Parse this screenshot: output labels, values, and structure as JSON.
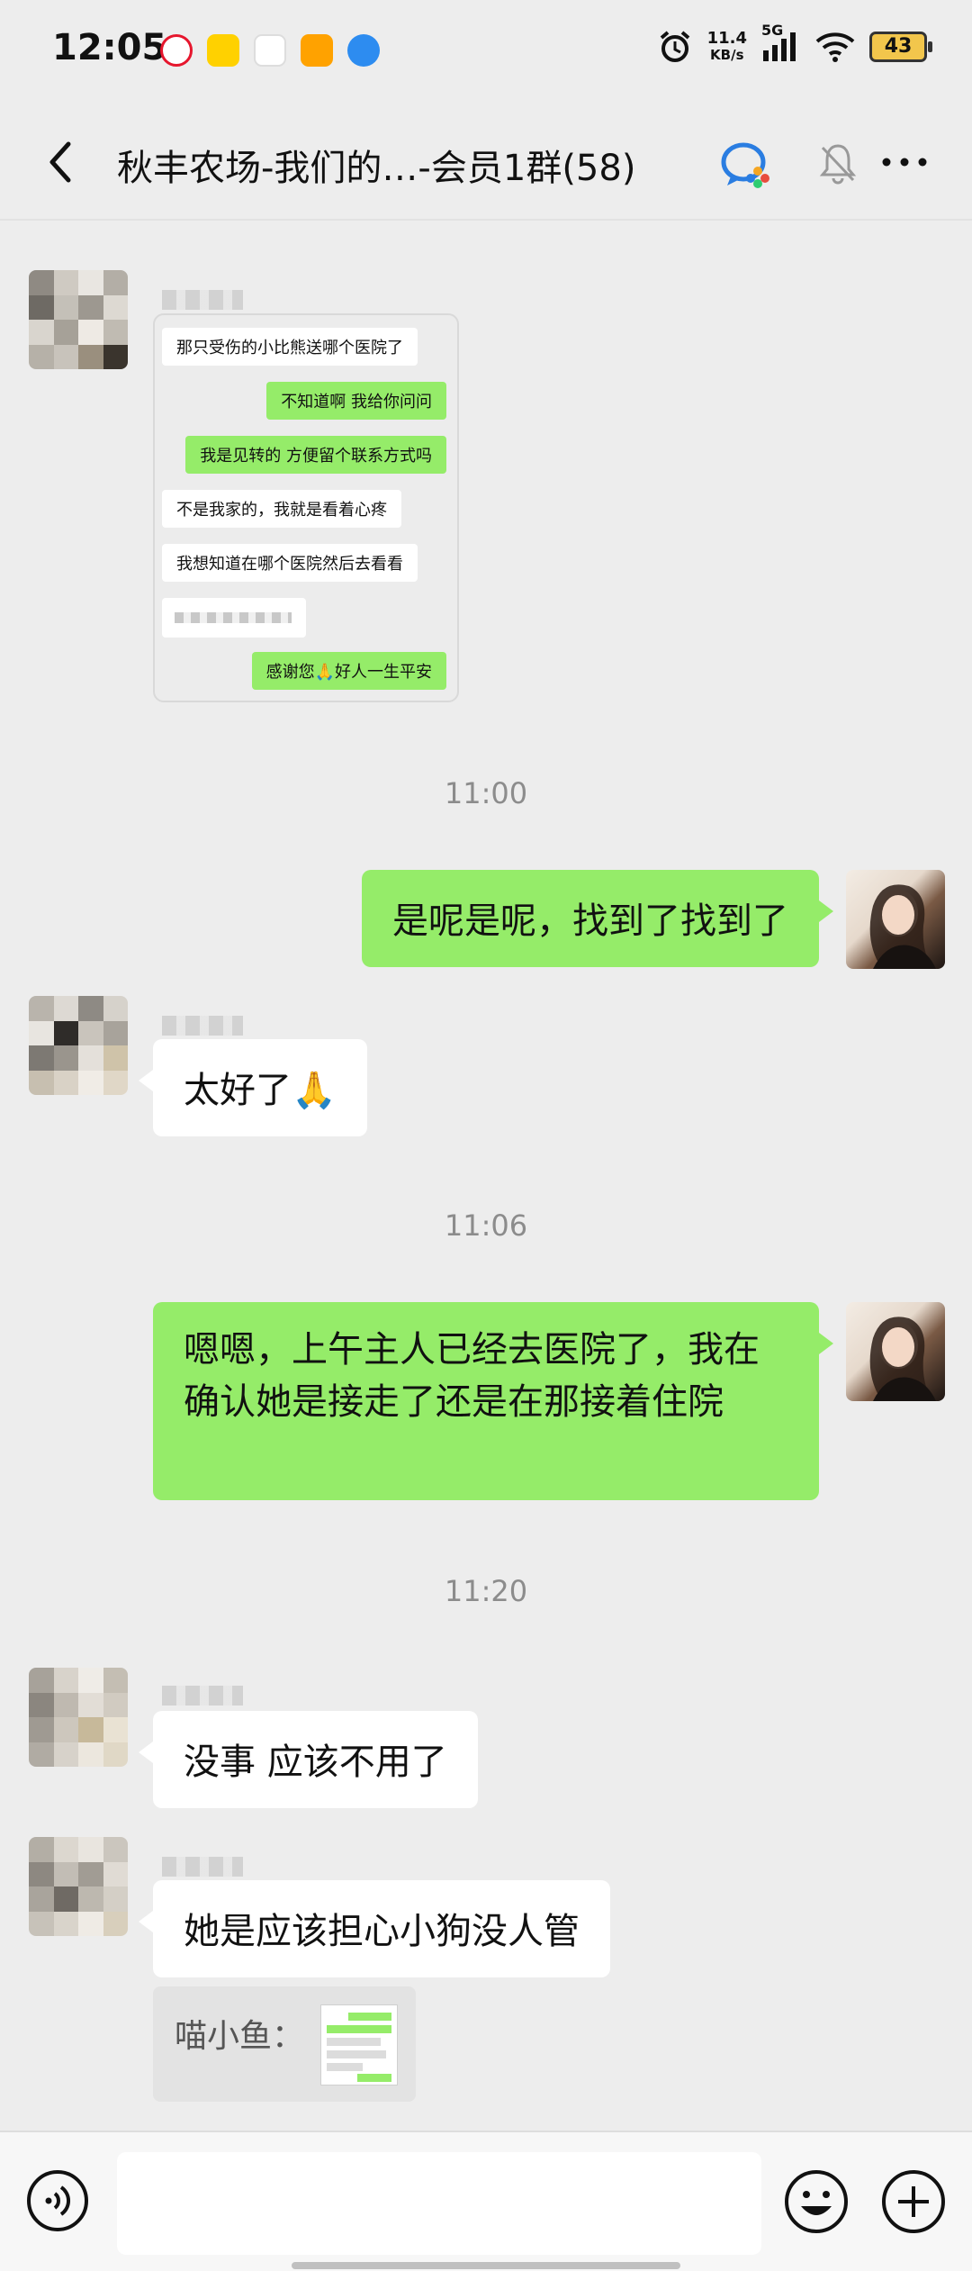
{
  "status_bar": {
    "time": "12:05",
    "network_speed_value": "11.4",
    "network_speed_unit": "KB/s",
    "network_type": "5G",
    "battery": "43",
    "app_icons": [
      "weibo-icon",
      "meituan-icon",
      "maps-icon",
      "notes-icon",
      "flash-icon"
    ]
  },
  "header": {
    "title": "秋丰农场-我们的…-会员1群(58)"
  },
  "forwarded_card": {
    "messages": [
      {
        "text": "那只受伤的小比熊送哪个医院了",
        "side": "left"
      },
      {
        "text": "不知道啊  我给你问问",
        "side": "right"
      },
      {
        "text": "我是见转的 方便留个联系方式吗",
        "side": "right"
      },
      {
        "text": "不是我家的，我就是看着心疼",
        "side": "left"
      },
      {
        "text": "我想知道在哪个医院然后去看看",
        "side": "left"
      },
      {
        "text": "",
        "side": "left"
      },
      {
        "text": "感谢您🙏好人一生平安",
        "side": "right"
      }
    ]
  },
  "messages": [
    {
      "type": "time",
      "text": "11:00"
    },
    {
      "type": "out",
      "text": "是呢是呢，找到了找到了"
    },
    {
      "type": "in",
      "text": "太好了🙏"
    },
    {
      "type": "time",
      "text": "11:06"
    },
    {
      "type": "out",
      "text": "嗯嗯，上午主人已经去医院了，我在确认她是接走了还是在那接着住院"
    },
    {
      "type": "time",
      "text": "11:20"
    },
    {
      "type": "in",
      "text": "没事 应该不用了"
    },
    {
      "type": "in",
      "text": "她是应该担心小狗没人管"
    }
  ],
  "quote": {
    "name": "喵小鱼："
  },
  "input_bar": {
    "placeholder": ""
  },
  "colors": {
    "accent_green": "#95ec69",
    "background": "#ededed",
    "bubble_white": "#ffffff"
  }
}
